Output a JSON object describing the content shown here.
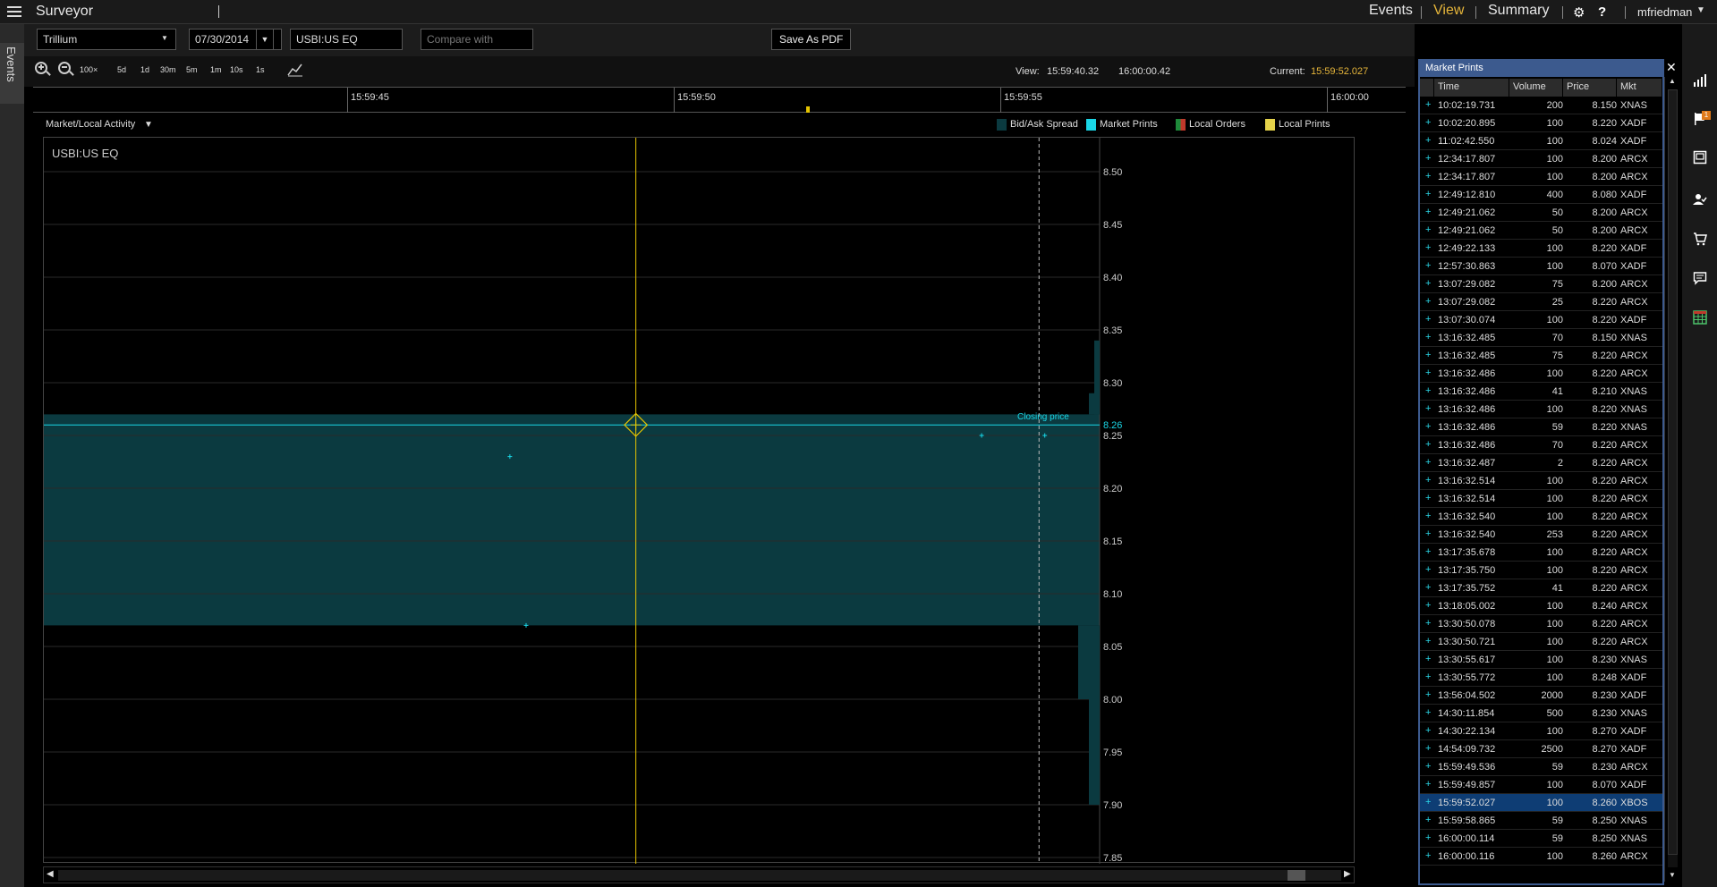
{
  "header": {
    "app_title": "Surveyor",
    "nav": [
      "Events",
      "View",
      "Summary"
    ],
    "active_nav": "View",
    "user": "mfriedman",
    "help": "?"
  },
  "left_tab": {
    "label": "Events"
  },
  "filters": {
    "firm": "Trillium",
    "date": "07/30/2014",
    "symbol": "USBI:US EQ",
    "compare_placeholder": "Compare with",
    "save_pdf": "Save As PDF"
  },
  "toolbar": {
    "zoom_100": "100×",
    "ranges": [
      "5d",
      "1d",
      "30m",
      "5m",
      "1m",
      "10s",
      "1s"
    ],
    "view_label": "View:",
    "view_start": "15:59:40.32",
    "view_end": "16:00:00.42",
    "current_label": "Current:",
    "current_value": "15:59:52.027"
  },
  "timeline": {
    "ticks": [
      "15:59:45",
      "15:59:50",
      "15:59:55",
      "16:00:00"
    ]
  },
  "activity": {
    "label": "Market/Local Activity",
    "legend": [
      {
        "name": "Bid/Ask Spread",
        "color": "#0b3a40"
      },
      {
        "name": "Market Prints",
        "color": "#1ad6e6"
      },
      {
        "name": "Local Orders",
        "color": "#c0392b"
      },
      {
        "name": "Local Prints",
        "color": "#e5d34a"
      }
    ]
  },
  "chart": {
    "symbol_label": "USBI:US EQ",
    "closing_label": "Closing price",
    "closing_value": "8.26"
  },
  "chart_data": {
    "type": "scatter",
    "ylim": [
      7.85,
      8.5
    ],
    "y_ticks": [
      "8.50",
      "8.45",
      "8.40",
      "8.35",
      "8.30",
      "8.25",
      "8.20",
      "8.15",
      "8.10",
      "8.05",
      "8.00",
      "7.95",
      "7.90",
      "7.85"
    ],
    "xlim": [
      "15:59:40.32",
      "16:00:00.42"
    ],
    "grid": true,
    "legend": "top-right",
    "series": [
      {
        "name": "Market Prints",
        "x": [
          "15:59:49.536",
          "15:59:49.857",
          "15:59:52.027",
          "15:59:58.865",
          "16:00:00.114"
        ],
        "y": [
          8.23,
          8.07,
          8.26,
          8.25,
          8.25
        ]
      }
    ],
    "spread": {
      "bid": 8.07,
      "ask": 8.27
    },
    "closing_price": 8.26,
    "current_time": "15:59:52.027"
  },
  "prints": {
    "title": "Market Prints",
    "columns": [
      "Time",
      "Volume",
      "Price",
      "Mkt"
    ],
    "rows": [
      [
        "10:02:19.731",
        "200",
        "8.150",
        "XNAS"
      ],
      [
        "10:02:20.895",
        "100",
        "8.220",
        "XADF"
      ],
      [
        "11:02:42.550",
        "100",
        "8.024",
        "XADF"
      ],
      [
        "12:34:17.807",
        "100",
        "8.200",
        "ARCX"
      ],
      [
        "12:34:17.807",
        "100",
        "8.200",
        "ARCX"
      ],
      [
        "12:49:12.810",
        "400",
        "8.080",
        "XADF"
      ],
      [
        "12:49:21.062",
        "50",
        "8.200",
        "ARCX"
      ],
      [
        "12:49:21.062",
        "50",
        "8.200",
        "ARCX"
      ],
      [
        "12:49:22.133",
        "100",
        "8.220",
        "XADF"
      ],
      [
        "12:57:30.863",
        "100",
        "8.070",
        "XADF"
      ],
      [
        "13:07:29.082",
        "75",
        "8.200",
        "ARCX"
      ],
      [
        "13:07:29.082",
        "25",
        "8.220",
        "ARCX"
      ],
      [
        "13:07:30.074",
        "100",
        "8.220",
        "XADF"
      ],
      [
        "13:16:32.485",
        "70",
        "8.150",
        "XNAS"
      ],
      [
        "13:16:32.485",
        "75",
        "8.220",
        "ARCX"
      ],
      [
        "13:16:32.486",
        "100",
        "8.220",
        "ARCX"
      ],
      [
        "13:16:32.486",
        "41",
        "8.210",
        "XNAS"
      ],
      [
        "13:16:32.486",
        "100",
        "8.220",
        "XNAS"
      ],
      [
        "13:16:32.486",
        "59",
        "8.220",
        "XNAS"
      ],
      [
        "13:16:32.486",
        "70",
        "8.220",
        "ARCX"
      ],
      [
        "13:16:32.487",
        "2",
        "8.220",
        "ARCX"
      ],
      [
        "13:16:32.514",
        "100",
        "8.220",
        "ARCX"
      ],
      [
        "13:16:32.514",
        "100",
        "8.220",
        "ARCX"
      ],
      [
        "13:16:32.540",
        "100",
        "8.220",
        "ARCX"
      ],
      [
        "13:16:32.540",
        "253",
        "8.220",
        "ARCX"
      ],
      [
        "13:17:35.678",
        "100",
        "8.220",
        "ARCX"
      ],
      [
        "13:17:35.750",
        "100",
        "8.220",
        "ARCX"
      ],
      [
        "13:17:35.752",
        "41",
        "8.220",
        "ARCX"
      ],
      [
        "13:18:05.002",
        "100",
        "8.240",
        "ARCX"
      ],
      [
        "13:30:50.078",
        "100",
        "8.220",
        "ARCX"
      ],
      [
        "13:30:50.721",
        "100",
        "8.220",
        "ARCX"
      ],
      [
        "13:30:55.617",
        "100",
        "8.230",
        "XNAS"
      ],
      [
        "13:30:55.772",
        "100",
        "8.248",
        "XADF"
      ],
      [
        "13:56:04.502",
        "2000",
        "8.230",
        "XADF"
      ],
      [
        "14:30:11.854",
        "500",
        "8.230",
        "XNAS"
      ],
      [
        "14:30:22.134",
        "100",
        "8.270",
        "XADF"
      ],
      [
        "14:54:09.732",
        "2500",
        "8.270",
        "XADF"
      ],
      [
        "15:59:49.536",
        "59",
        "8.230",
        "ARCX"
      ],
      [
        "15:59:49.857",
        "100",
        "8.070",
        "XADF"
      ],
      [
        "15:59:52.027",
        "100",
        "8.260",
        "XBOS"
      ],
      [
        "15:59:58.865",
        "59",
        "8.250",
        "XNAS"
      ],
      [
        "16:00:00.114",
        "59",
        "8.250",
        "XNAS"
      ],
      [
        "16:00:00.116",
        "100",
        "8.260",
        "ARCX"
      ]
    ],
    "selected_index": 39
  },
  "sidebar": {
    "icons": [
      "chart-icon",
      "flag-icon",
      "window-icon",
      "user-check-icon",
      "cart-icon",
      "comment-icon",
      "table-icon"
    ],
    "flag_badge": "1"
  },
  "colors": {
    "accent": "#e5b53a",
    "spread": "#0b3a40",
    "prints": "#1ad6e6",
    "panel": "#3c5a8e"
  }
}
